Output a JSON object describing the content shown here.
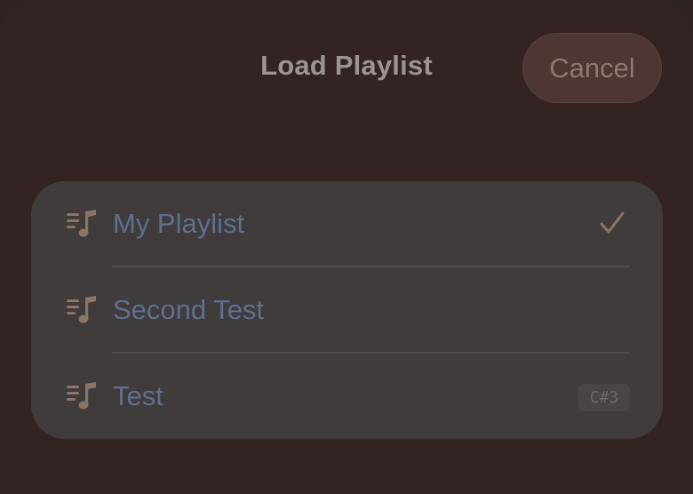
{
  "header": {
    "title": "Load Playlist",
    "cancel_label": "Cancel"
  },
  "playlists": {
    "items": [
      {
        "label": "My Playlist",
        "icon": "playlist-icon",
        "selected": true
      },
      {
        "label": "Second Test",
        "icon": "playlist-icon",
        "selected": false
      },
      {
        "label": "Test",
        "icon": "playlist-icon",
        "selected": false,
        "shortcut": "C#3"
      }
    ]
  },
  "colors": {
    "background": "#332322",
    "list_background": "#3f3c3b",
    "item_text": "#5f6f8f",
    "icon": "#8b7568",
    "checkmark": "#8a7266",
    "cancel_button": "#4d3633"
  }
}
